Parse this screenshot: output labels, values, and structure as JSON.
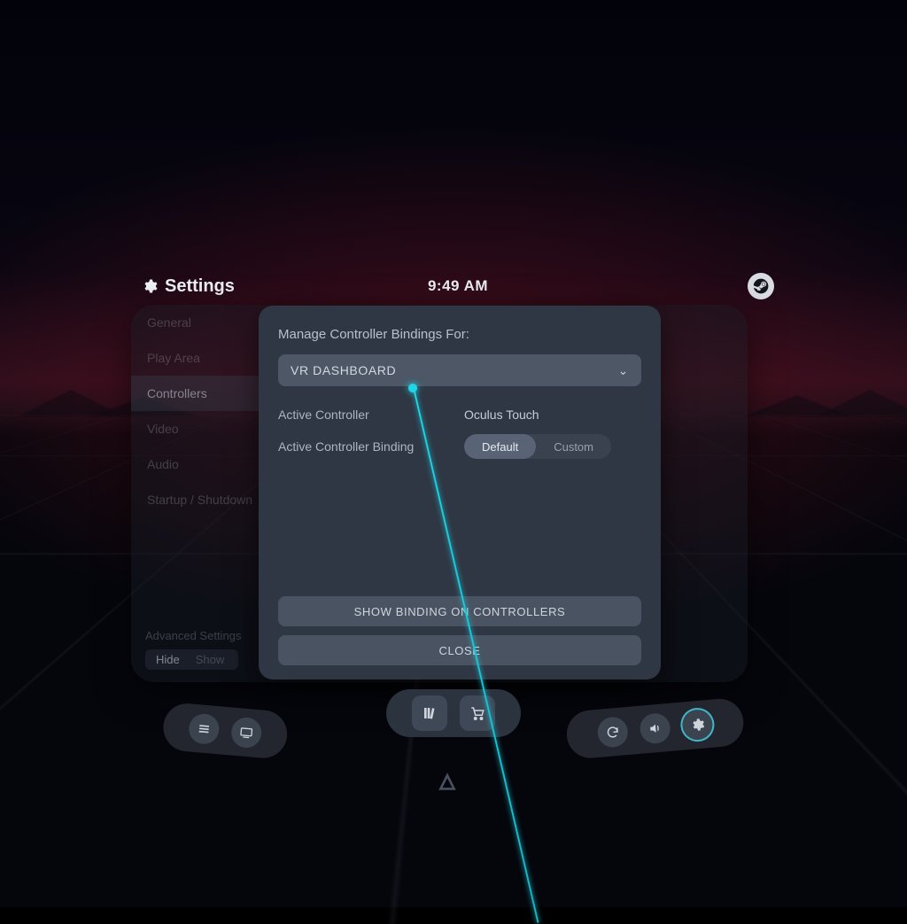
{
  "header": {
    "title": "Settings",
    "clock": "9:49 AM"
  },
  "sidebar": {
    "items": [
      {
        "label": "General"
      },
      {
        "label": "Play Area"
      },
      {
        "label": "Controllers"
      },
      {
        "label": "Video"
      },
      {
        "label": "Audio"
      },
      {
        "label": "Startup / Shutdown"
      }
    ],
    "advanced_label": "Advanced Settings",
    "advanced_hide": "Hide",
    "advanced_show": "Show"
  },
  "modal": {
    "title": "Manage Controller Bindings For:",
    "selected_app": "VR DASHBOARD",
    "active_controller_label": "Active Controller",
    "active_controller_value": "Oculus Touch",
    "active_binding_label": "Active Controller Binding",
    "segment_default": "Default",
    "segment_custom": "Custom",
    "show_binding_button": "SHOW BINDING ON CONTROLLERS",
    "close_button": "CLOSE"
  },
  "dock": {
    "menu": "menu",
    "desktop": "desktop",
    "library": "library",
    "store": "store",
    "refresh": "refresh",
    "volume": "volume",
    "settings": "settings"
  }
}
